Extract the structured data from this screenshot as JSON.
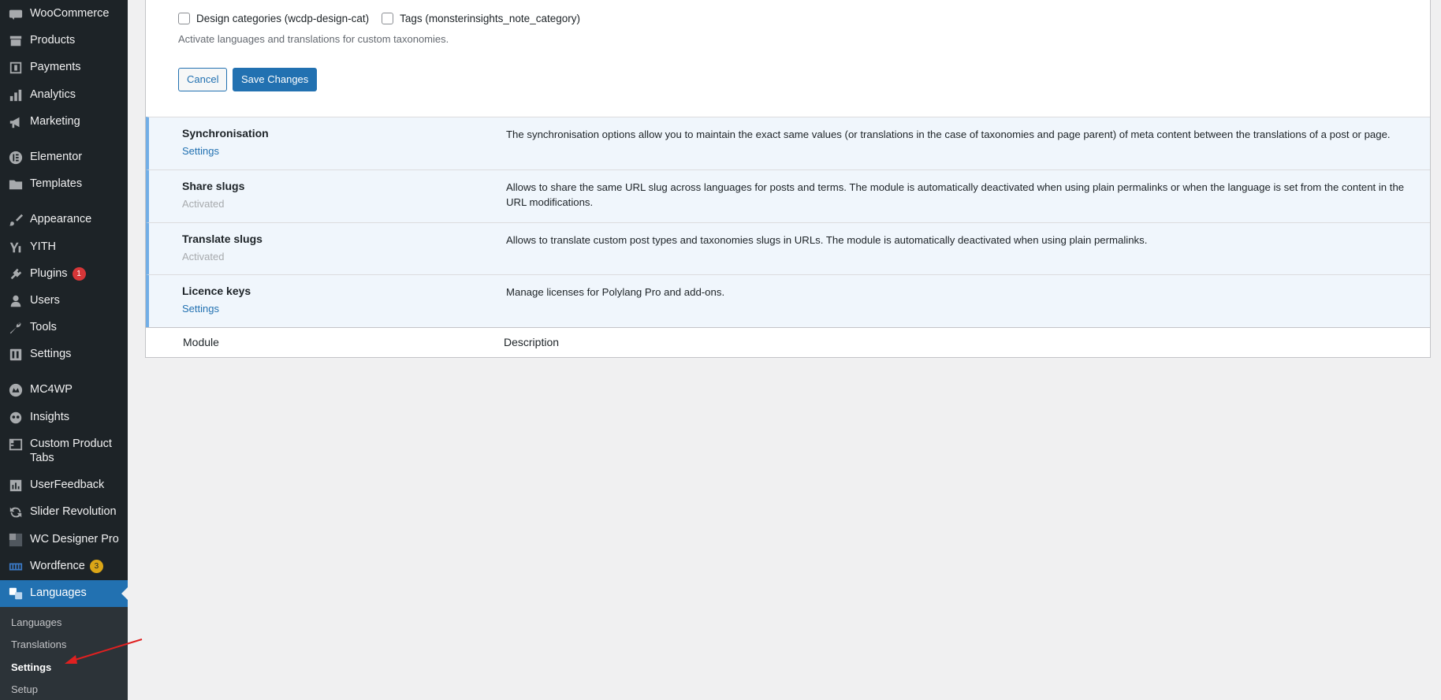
{
  "sidebar": {
    "items": [
      {
        "label": "WooCommerce",
        "icon": "woocommerce-icon"
      },
      {
        "label": "Products",
        "icon": "archive-icon"
      },
      {
        "label": "Payments",
        "icon": "payments-icon"
      },
      {
        "label": "Analytics",
        "icon": "bar-chart-icon"
      },
      {
        "label": "Marketing",
        "icon": "megaphone-icon"
      },
      {
        "label": "Elementor",
        "icon": "elementor-icon"
      },
      {
        "label": "Templates",
        "icon": "folder-icon"
      },
      {
        "label": "Appearance",
        "icon": "paintbrush-icon"
      },
      {
        "label": "YITH",
        "icon": "yith-icon"
      },
      {
        "label": "Plugins",
        "icon": "plugin-icon",
        "badge": "1"
      },
      {
        "label": "Users",
        "icon": "user-icon"
      },
      {
        "label": "Tools",
        "icon": "wrench-icon"
      },
      {
        "label": "Settings",
        "icon": "settings-icon"
      },
      {
        "label": "MC4WP",
        "icon": "mc4wp-icon"
      },
      {
        "label": "Insights",
        "icon": "insights-icon"
      },
      {
        "label": "Custom Product Tabs",
        "icon": "tabs-icon"
      },
      {
        "label": "UserFeedback",
        "icon": "feedback-icon"
      },
      {
        "label": "Slider Revolution",
        "icon": "refresh-icon"
      },
      {
        "label": "WC Designer Pro",
        "icon": "designer-icon"
      },
      {
        "label": "Wordfence",
        "icon": "wordfence-icon",
        "badge": "3"
      },
      {
        "label": "Languages",
        "icon": "translation-icon"
      }
    ],
    "submenu": [
      {
        "label": "Languages"
      },
      {
        "label": "Translations"
      },
      {
        "label": "Settings"
      },
      {
        "label": "Setup"
      }
    ]
  },
  "taxonomies": {
    "options": [
      {
        "label": "Design categories (wcdp-design-cat)",
        "checked": false
      },
      {
        "label": "Tags (monsterinsights_note_category)",
        "checked": false
      }
    ],
    "help": "Activate languages and translations for custom taxonomies."
  },
  "buttons": {
    "cancel": "Cancel",
    "save": "Save Changes"
  },
  "modules": [
    {
      "name": "Synchronisation",
      "action": "Settings",
      "description": "The synchronisation options allow you to maintain the exact same values (or translations in the case of taxonomies and page parent) of meta content between the translations of a post or page."
    },
    {
      "name": "Share slugs",
      "action": "Activated",
      "description": "Allows to share the same URL slug across languages for posts and terms. The module is automatically deactivated when using plain permalinks or when the language is set from the content in the URL modifications."
    },
    {
      "name": "Translate slugs",
      "action": "Activated",
      "description": "Allows to translate custom post types and taxonomies slugs in URLs. The module is automatically deactivated when using plain permalinks."
    },
    {
      "name": "Licence keys",
      "action": "Settings",
      "description": "Manage licenses for Polylang Pro and add-ons."
    }
  ],
  "table_footer": {
    "module": "Module",
    "description": "Description"
  },
  "colors": {
    "sidebar": "#1d2327",
    "active": "#2271b1",
    "accent_border": "#72aee6",
    "row_bg": "#f0f6fc",
    "annotation": "#e02020"
  }
}
